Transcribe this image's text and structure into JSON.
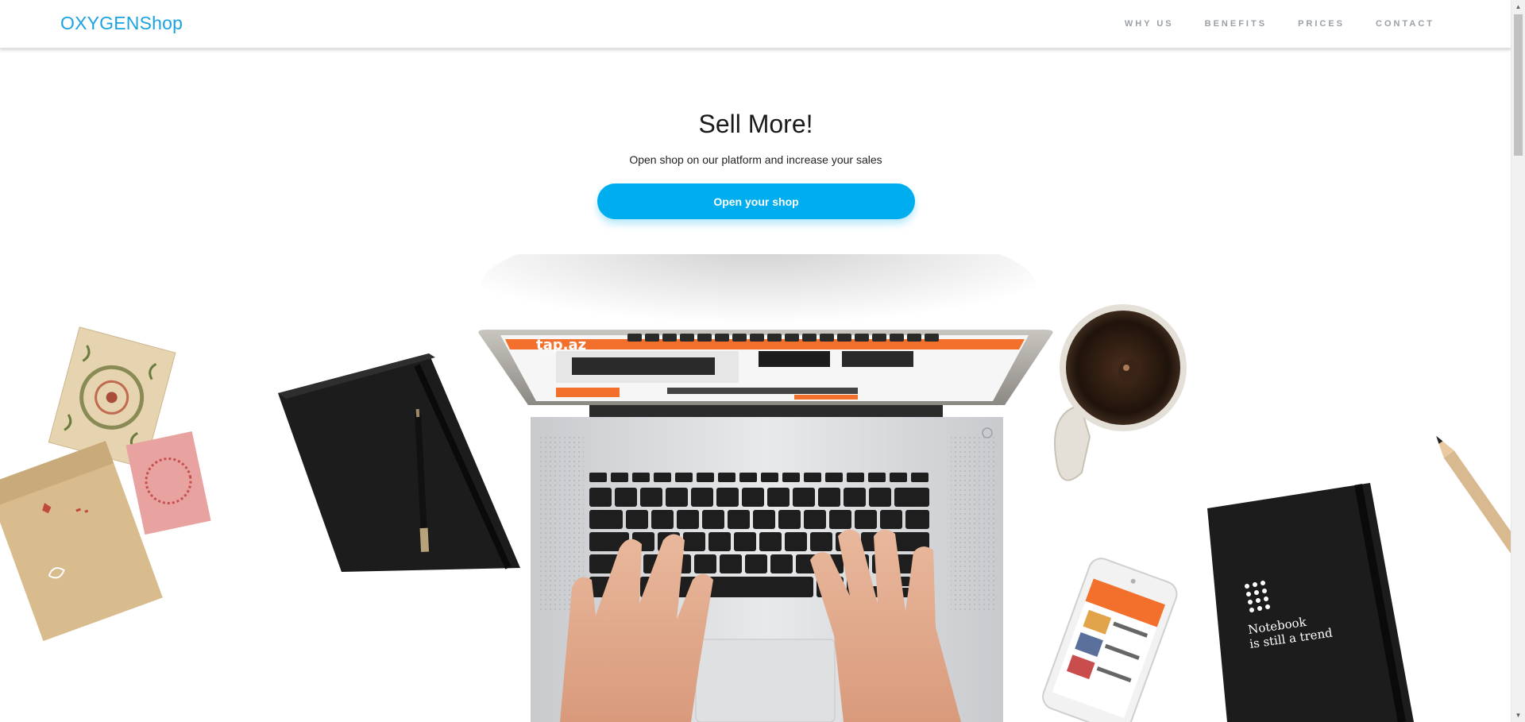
{
  "brand": {
    "name": "OXYGENShop"
  },
  "nav": {
    "items": [
      {
        "label": "WHY US"
      },
      {
        "label": "BENEFITS"
      },
      {
        "label": "PRICES"
      },
      {
        "label": "CONTACT"
      }
    ]
  },
  "hero": {
    "title": "Sell More!",
    "subtitle": "Open shop on our platform and increase your sales",
    "cta_label": "Open your shop"
  },
  "illustration": {
    "screen_logo": "tap.az",
    "notebook_text_line1": "Notebook",
    "notebook_text_line2": "is still a trend"
  },
  "colors": {
    "accent": "#00aeef",
    "brand": "#1ba3e0",
    "nav_text": "#9aa0a6",
    "screen_orange": "#f26f2c"
  },
  "icons": [
    "scroll-up-arrow-icon",
    "scroll-down-arrow-icon"
  ]
}
